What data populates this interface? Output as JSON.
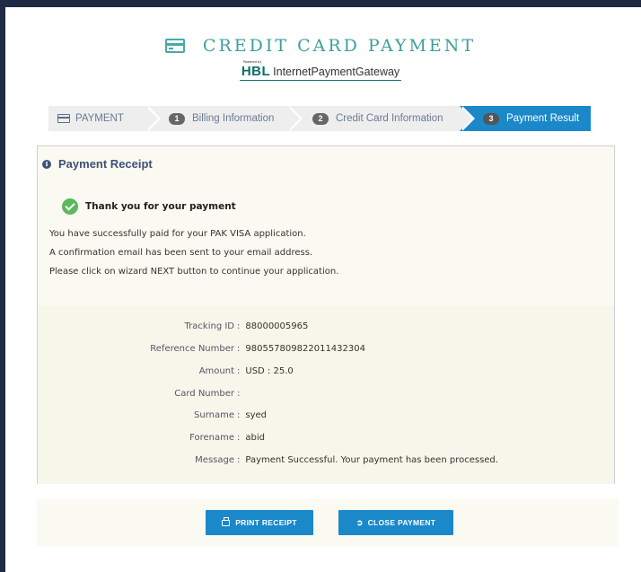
{
  "header": {
    "title": "CREDIT CARD PAYMENT",
    "powered_by": "Powered by",
    "brand_hbl": "HBL",
    "brand_gateway": "InternetPaymentGateway"
  },
  "wizard": {
    "steps": [
      {
        "label": "PAYMENT",
        "number": ""
      },
      {
        "label": "Billing Information",
        "number": "1"
      },
      {
        "label": "Credit Card Information",
        "number": "2"
      },
      {
        "label": "Payment Result",
        "number": "3"
      }
    ],
    "active_step": 3
  },
  "receipt": {
    "title": "Payment Receipt",
    "thanks": "Thank you for your payment",
    "messages": [
      "You have successfully paid for your PAK VISA application.",
      "A confirmation email has been sent to your email address.",
      "Please click on wizard NEXT button to continue your application."
    ],
    "details": [
      {
        "label": "Tracking ID",
        "value": "88000005965"
      },
      {
        "label": "Reference Number",
        "value": "980557809822011432304"
      },
      {
        "label": "Amount",
        "value": "USD : 25.0"
      },
      {
        "label": "Card Number",
        "value": ""
      },
      {
        "label": "Surname",
        "value": "syed"
      },
      {
        "label": "Forename",
        "value": "abid"
      },
      {
        "label": "Message",
        "value": "Payment Successful. Your payment has been processed."
      }
    ]
  },
  "actions": {
    "print_label": "PRINT RECEIPT",
    "close_label": "CLOSE PAYMENT"
  },
  "colors": {
    "accent": "#1a88c9",
    "title_teal": "#3e9f9c",
    "success": "#5cb85c",
    "panel_bg": "#fafaf2"
  }
}
